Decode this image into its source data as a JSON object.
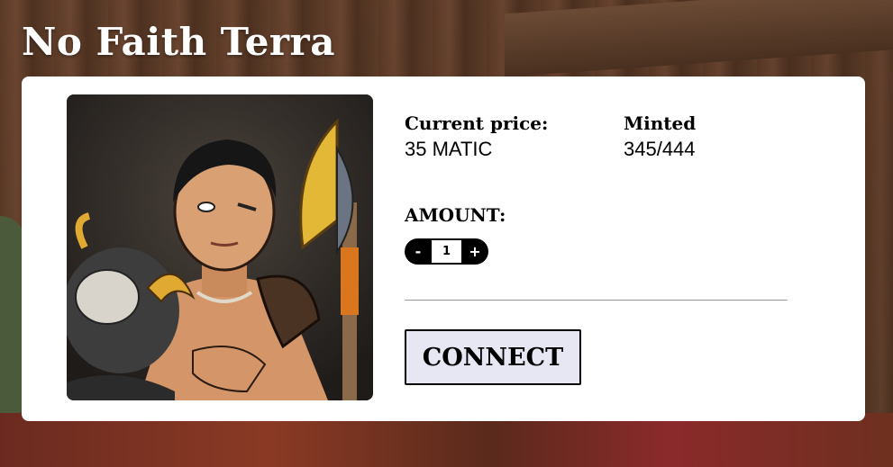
{
  "page": {
    "title": "No Faith Terra"
  },
  "mint_card": {
    "price_label": "Current price:",
    "price_value": "35 MATIC",
    "minted_label": "Minted",
    "minted_value": "345/444",
    "amount_label": "AMOUNT:",
    "stepper": {
      "minus_label": "-",
      "value": "1",
      "plus_label": "+"
    },
    "connect_label": "CONNECT"
  },
  "colors": {
    "card_bg": "#ffffff",
    "button_bg": "#e7e7f3",
    "stepper_bg": "#000000",
    "divider": "#9a9a9a"
  }
}
